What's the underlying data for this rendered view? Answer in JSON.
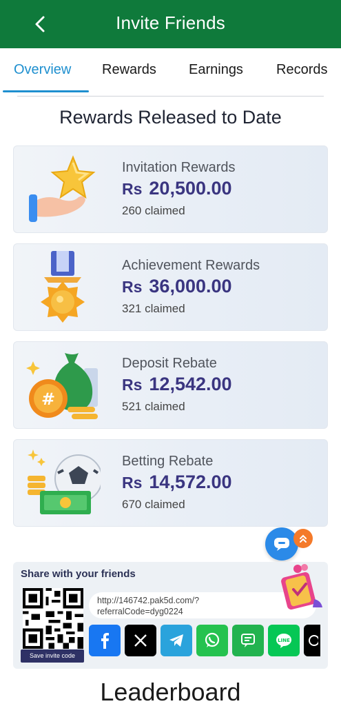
{
  "header": {
    "title": "Invite Friends"
  },
  "tabs": [
    {
      "label": "Overview",
      "active": true
    },
    {
      "label": "Rewards",
      "active": false
    },
    {
      "label": "Earnings",
      "active": false
    },
    {
      "label": "Records",
      "active": false
    }
  ],
  "section_title": "Rewards Released to Date",
  "rewards": [
    {
      "label": "Invitation Rewards",
      "currency": "Rs",
      "amount": "20,500.00",
      "claimed": "260 claimed",
      "icon": "star-hand-icon"
    },
    {
      "label": "Achievement Rewards",
      "currency": "Rs",
      "amount": "36,000.00",
      "claimed": "321 claimed",
      "icon": "medal-icon"
    },
    {
      "label": "Deposit Rebate",
      "currency": "Rs",
      "amount": "12,542.00",
      "claimed": "521 claimed",
      "icon": "money-bag-icon"
    },
    {
      "label": "Betting Rebate",
      "currency": "Rs",
      "amount": "14,572.00",
      "claimed": "670 claimed",
      "icon": "soccer-cash-icon"
    }
  ],
  "share": {
    "title": "Share with your friends",
    "link_line1": "http://146742.pak5d.com/?",
    "link_line2": "referralCode=dyg0224",
    "save_code": "Save invite code",
    "socials": [
      "facebook-icon",
      "x-icon",
      "telegram-icon",
      "whatsapp-icon",
      "sms-icon",
      "line-icon",
      "threads-icon"
    ]
  },
  "leaderboard_title": "Leaderboard",
  "colors": {
    "header_green": "#0f7a3b",
    "tab_active": "#1e8fcf",
    "amount_purple": "#3a3580"
  }
}
